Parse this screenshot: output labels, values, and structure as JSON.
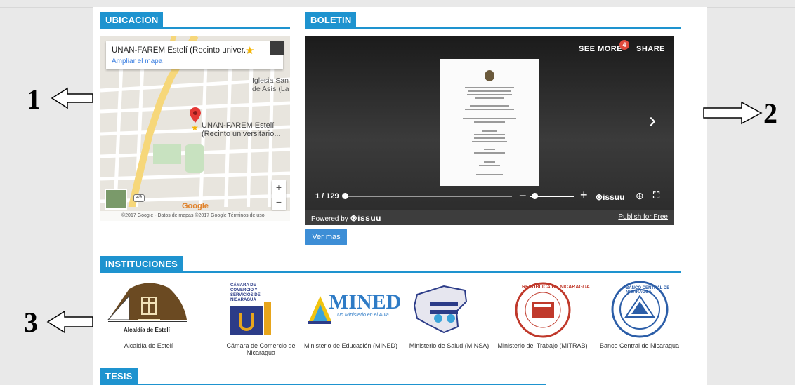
{
  "sections": {
    "ubicacion": "UBICACION",
    "boletin": "BOLETIN",
    "instituciones": "INSTITUCIONES",
    "tesis": "TESIS"
  },
  "map": {
    "place_title": "UNAN-FAREM Estelí (Recinto univer...",
    "expand_link": "Ampliar el mapa",
    "church_label_1": "Iglesia San",
    "church_label_2": "de Asís (La",
    "pin_label_1": "UNAN-FAREM Estelí",
    "pin_label_2": "(Recinto universitario...",
    "road_badge": "49",
    "google_logo": "Google",
    "zoom_in": "+",
    "zoom_out": "−",
    "footer": "©2017 Google - Datos de mapas ©2017 Google   Términos de uso"
  },
  "viewer": {
    "see_more": "SEE MORE",
    "badge_count": "4",
    "share": "SHARE",
    "page_indicator": "1 / 129",
    "issuu_label": "issuu",
    "powered_by": "Powered by",
    "brand": "issuu",
    "publish": "Publish for Free",
    "next_icon": "›",
    "zoom_in": "+",
    "zoom_out": "−"
  },
  "ver_mas": "Ver mas",
  "institutions": [
    {
      "name": "Alcaldía de Estelí",
      "logo_text": "Alcaldía de Estelí"
    },
    {
      "name": "Cámara de Comercio de Nicaragua",
      "logo_text": "CÁMARA DE COMERCIO Y SERVICIOS DE NICARAGUA"
    },
    {
      "name": "Ministerio de Educación (MINED)",
      "logo_text": "MINED"
    },
    {
      "name": "Ministerio de Salud (MINSA)",
      "logo_text": ""
    },
    {
      "name": "Ministerio del Trabajo (MITRAB)",
      "logo_text": "REPUBLICA DE NICARAGUA"
    },
    {
      "name": "Banco Central de Nicaragua",
      "logo_text": "BANCO CENTRAL DE NICARAGUA"
    }
  ],
  "annotations": [
    "1",
    "2",
    "3"
  ],
  "colors": {
    "accent": "#1e93cf",
    "button": "#3d8ed6",
    "page_bg": "#e9e9e9"
  }
}
